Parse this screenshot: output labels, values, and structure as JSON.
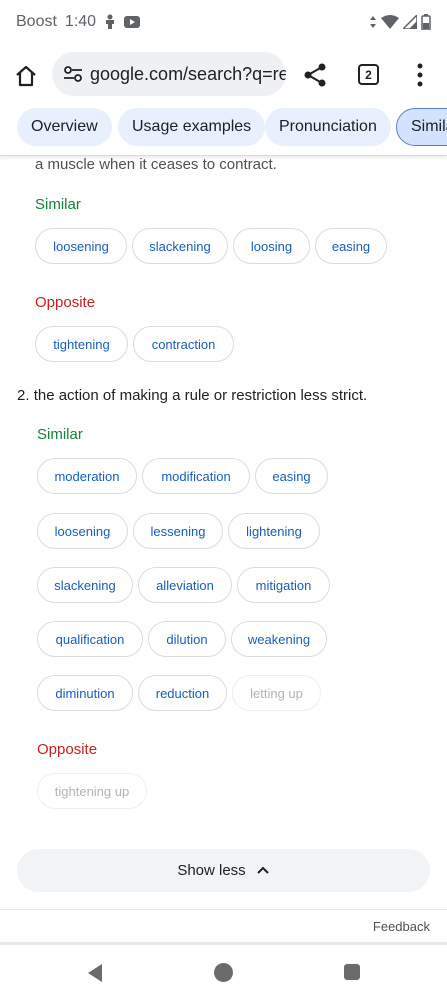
{
  "status_bar": {
    "carrier": "Boost",
    "time": "1:40"
  },
  "browser": {
    "url": "google.com/search?q=re",
    "tab_count": "2"
  },
  "nav_chips": [
    "Overview",
    "Usage examples",
    "Pronunciation",
    "Simila"
  ],
  "content": {
    "cut_text": "a muscle when it ceases to contract.",
    "sense1": {
      "similar_label": "Similar",
      "similar": [
        "loosening",
        "slackening",
        "loosing",
        "easing"
      ],
      "opposite_label": "Opposite",
      "opposite": [
        "tightening",
        "contraction"
      ]
    },
    "sense2": {
      "number": "2.",
      "definition": "the action of making a rule or restriction less strict.",
      "similar_label": "Similar",
      "similar_rows": [
        [
          "moderation",
          "modification",
          "easing"
        ],
        [
          "loosening",
          "lessening",
          "lightening"
        ],
        [
          "slackening",
          "alleviation",
          "mitigation"
        ],
        [
          "qualification",
          "dilution",
          "weakening"
        ],
        [
          "diminution",
          "reduction",
          "letting up"
        ]
      ],
      "opposite_label": "Opposite",
      "opposite": [
        "tightening up"
      ]
    }
  },
  "show_less": "Show less",
  "feedback": "Feedback",
  "colors": {
    "similar": "#188038",
    "opposite": "#c5221f",
    "chip_text": "#1a5dba",
    "nav_chip_bg": "#e8f0fe"
  },
  "icons": [
    "home-icon",
    "site-settings-icon",
    "share-icon",
    "tab-switcher-icon",
    "more-vert-icon",
    "chevron-up-icon",
    "back-icon",
    "home-circle-icon",
    "recents-icon"
  ]
}
